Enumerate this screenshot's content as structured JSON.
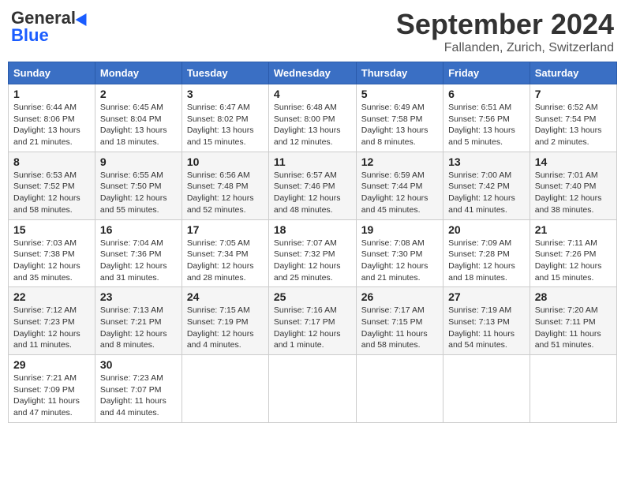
{
  "header": {
    "logo_general": "General",
    "logo_blue": "Blue",
    "month_title": "September 2024",
    "subtitle": "Fallanden, Zurich, Switzerland"
  },
  "days_of_week": [
    "Sunday",
    "Monday",
    "Tuesday",
    "Wednesday",
    "Thursday",
    "Friday",
    "Saturday"
  ],
  "weeks": [
    [
      {
        "day": "1",
        "sunrise": "Sunrise: 6:44 AM",
        "sunset": "Sunset: 8:06 PM",
        "daylight": "Daylight: 13 hours and 21 minutes."
      },
      {
        "day": "2",
        "sunrise": "Sunrise: 6:45 AM",
        "sunset": "Sunset: 8:04 PM",
        "daylight": "Daylight: 13 hours and 18 minutes."
      },
      {
        "day": "3",
        "sunrise": "Sunrise: 6:47 AM",
        "sunset": "Sunset: 8:02 PM",
        "daylight": "Daylight: 13 hours and 15 minutes."
      },
      {
        "day": "4",
        "sunrise": "Sunrise: 6:48 AM",
        "sunset": "Sunset: 8:00 PM",
        "daylight": "Daylight: 13 hours and 12 minutes."
      },
      {
        "day": "5",
        "sunrise": "Sunrise: 6:49 AM",
        "sunset": "Sunset: 7:58 PM",
        "daylight": "Daylight: 13 hours and 8 minutes."
      },
      {
        "day": "6",
        "sunrise": "Sunrise: 6:51 AM",
        "sunset": "Sunset: 7:56 PM",
        "daylight": "Daylight: 13 hours and 5 minutes."
      },
      {
        "day": "7",
        "sunrise": "Sunrise: 6:52 AM",
        "sunset": "Sunset: 7:54 PM",
        "daylight": "Daylight: 13 hours and 2 minutes."
      }
    ],
    [
      {
        "day": "8",
        "sunrise": "Sunrise: 6:53 AM",
        "sunset": "Sunset: 7:52 PM",
        "daylight": "Daylight: 12 hours and 58 minutes."
      },
      {
        "day": "9",
        "sunrise": "Sunrise: 6:55 AM",
        "sunset": "Sunset: 7:50 PM",
        "daylight": "Daylight: 12 hours and 55 minutes."
      },
      {
        "day": "10",
        "sunrise": "Sunrise: 6:56 AM",
        "sunset": "Sunset: 7:48 PM",
        "daylight": "Daylight: 12 hours and 52 minutes."
      },
      {
        "day": "11",
        "sunrise": "Sunrise: 6:57 AM",
        "sunset": "Sunset: 7:46 PM",
        "daylight": "Daylight: 12 hours and 48 minutes."
      },
      {
        "day": "12",
        "sunrise": "Sunrise: 6:59 AM",
        "sunset": "Sunset: 7:44 PM",
        "daylight": "Daylight: 12 hours and 45 minutes."
      },
      {
        "day": "13",
        "sunrise": "Sunrise: 7:00 AM",
        "sunset": "Sunset: 7:42 PM",
        "daylight": "Daylight: 12 hours and 41 minutes."
      },
      {
        "day": "14",
        "sunrise": "Sunrise: 7:01 AM",
        "sunset": "Sunset: 7:40 PM",
        "daylight": "Daylight: 12 hours and 38 minutes."
      }
    ],
    [
      {
        "day": "15",
        "sunrise": "Sunrise: 7:03 AM",
        "sunset": "Sunset: 7:38 PM",
        "daylight": "Daylight: 12 hours and 35 minutes."
      },
      {
        "day": "16",
        "sunrise": "Sunrise: 7:04 AM",
        "sunset": "Sunset: 7:36 PM",
        "daylight": "Daylight: 12 hours and 31 minutes."
      },
      {
        "day": "17",
        "sunrise": "Sunrise: 7:05 AM",
        "sunset": "Sunset: 7:34 PM",
        "daylight": "Daylight: 12 hours and 28 minutes."
      },
      {
        "day": "18",
        "sunrise": "Sunrise: 7:07 AM",
        "sunset": "Sunset: 7:32 PM",
        "daylight": "Daylight: 12 hours and 25 minutes."
      },
      {
        "day": "19",
        "sunrise": "Sunrise: 7:08 AM",
        "sunset": "Sunset: 7:30 PM",
        "daylight": "Daylight: 12 hours and 21 minutes."
      },
      {
        "day": "20",
        "sunrise": "Sunrise: 7:09 AM",
        "sunset": "Sunset: 7:28 PM",
        "daylight": "Daylight: 12 hours and 18 minutes."
      },
      {
        "day": "21",
        "sunrise": "Sunrise: 7:11 AM",
        "sunset": "Sunset: 7:26 PM",
        "daylight": "Daylight: 12 hours and 15 minutes."
      }
    ],
    [
      {
        "day": "22",
        "sunrise": "Sunrise: 7:12 AM",
        "sunset": "Sunset: 7:23 PM",
        "daylight": "Daylight: 12 hours and 11 minutes."
      },
      {
        "day": "23",
        "sunrise": "Sunrise: 7:13 AM",
        "sunset": "Sunset: 7:21 PM",
        "daylight": "Daylight: 12 hours and 8 minutes."
      },
      {
        "day": "24",
        "sunrise": "Sunrise: 7:15 AM",
        "sunset": "Sunset: 7:19 PM",
        "daylight": "Daylight: 12 hours and 4 minutes."
      },
      {
        "day": "25",
        "sunrise": "Sunrise: 7:16 AM",
        "sunset": "Sunset: 7:17 PM",
        "daylight": "Daylight: 12 hours and 1 minute."
      },
      {
        "day": "26",
        "sunrise": "Sunrise: 7:17 AM",
        "sunset": "Sunset: 7:15 PM",
        "daylight": "Daylight: 11 hours and 58 minutes."
      },
      {
        "day": "27",
        "sunrise": "Sunrise: 7:19 AM",
        "sunset": "Sunset: 7:13 PM",
        "daylight": "Daylight: 11 hours and 54 minutes."
      },
      {
        "day": "28",
        "sunrise": "Sunrise: 7:20 AM",
        "sunset": "Sunset: 7:11 PM",
        "daylight": "Daylight: 11 hours and 51 minutes."
      }
    ],
    [
      {
        "day": "29",
        "sunrise": "Sunrise: 7:21 AM",
        "sunset": "Sunset: 7:09 PM",
        "daylight": "Daylight: 11 hours and 47 minutes."
      },
      {
        "day": "30",
        "sunrise": "Sunrise: 7:23 AM",
        "sunset": "Sunset: 7:07 PM",
        "daylight": "Daylight: 11 hours and 44 minutes."
      },
      null,
      null,
      null,
      null,
      null
    ]
  ]
}
